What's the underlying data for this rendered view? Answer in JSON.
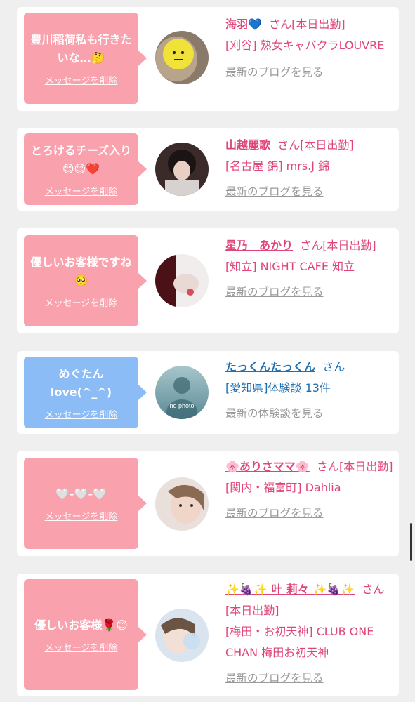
{
  "cards": [
    {
      "message": "豊川稲荷私も行きたいな…🤔",
      "delete_label": "メッセージを削除",
      "name": "海羽💙",
      "status": "さん[本日出勤]",
      "area": "[刈谷] 熟女キャバクラLOUVRE",
      "link": "最新のブログを見る"
    },
    {
      "message": "とろけるチーズ入り😊😊❤️",
      "delete_label": "メッセージを削除",
      "name": "山越麗歌",
      "status": "さん[本日出勤]",
      "area": "[名古屋 錦] mrs.J 錦",
      "link": "最新のブログを見る"
    },
    {
      "message": "優しいお客様ですね🥺",
      "delete_label": "メッセージを削除",
      "name": "星乃　あかり",
      "status": "さん[本日出勤]",
      "area": "[知立] NIGHT CAFE 知立",
      "link": "最新のブログを見る"
    },
    {
      "message": "めぐたんlove(^_^)",
      "delete_label": "メッセージを削除",
      "name": "たっくんたっくん",
      "status": "さん",
      "area": "[愛知県]体験談 13件",
      "link": "最新の体験談を見る",
      "avatar_text": "no photo"
    },
    {
      "message": "🤍-🤍-🤍",
      "delete_label": "メッセージを削除",
      "name": "🌸ありさママ🌸",
      "status": "さん[本日出勤]",
      "area": "[関内・福富町] Dahlia",
      "link": "最新のブログを見る"
    },
    {
      "message": "優しいお客様🌹😊",
      "delete_label": "メッセージを削除",
      "name": "✨🍇✨ 叶 莉々 ✨🍇✨",
      "status": "さん[本日出勤]",
      "area": "[梅田・お初天神] CLUB ONE CHAN 梅田お初天神",
      "link": "最新のブログを見る"
    }
  ],
  "colors": {
    "pink_bubble": "#f9a1ad",
    "blue_bubble": "#8bbcf5",
    "pink_text": "#e0457a",
    "blue_text": "#1f6fb2"
  }
}
